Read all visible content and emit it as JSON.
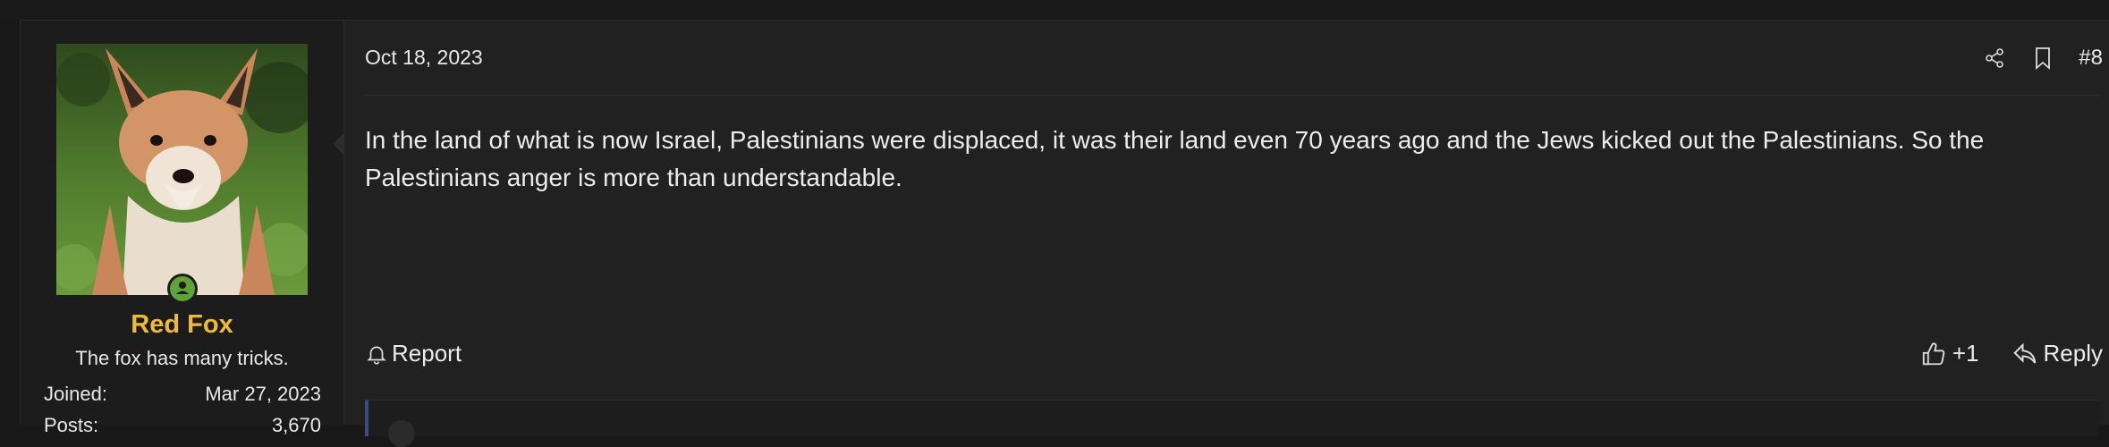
{
  "post": {
    "date": "Oct 18, 2023",
    "number": "#8",
    "body": "In the land of what is now Israel, Palestinians were displaced, it was their land even 70 years ago and the Jews kicked out the Palestinians. So the Palestinians anger is more than understandable."
  },
  "user": {
    "name": "Red Fox",
    "title": "The fox has many tricks.",
    "stats": [
      {
        "label": "Joined:",
        "value": "Mar 27, 2023"
      },
      {
        "label": "Posts:",
        "value": "3,670"
      }
    ]
  },
  "actions": {
    "report": "Report",
    "like": "+1",
    "reply": "Reply"
  },
  "colors": {
    "username": "#f0b93a",
    "online_badge": "#5fa33a",
    "background": "#212121"
  }
}
